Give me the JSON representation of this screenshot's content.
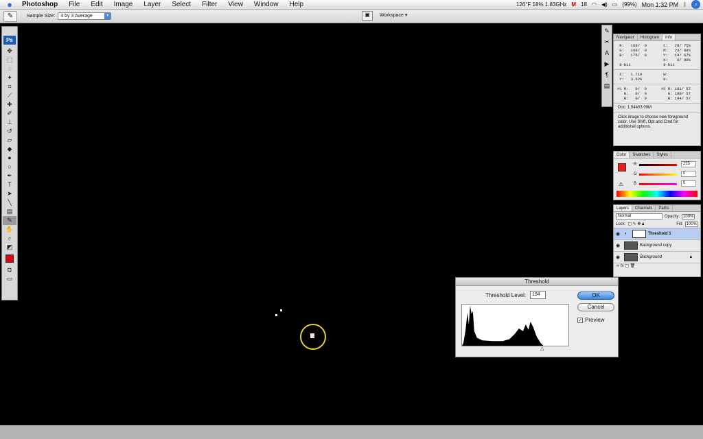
{
  "menubar": {
    "app": "Photoshop",
    "items": [
      "File",
      "Edit",
      "Image",
      "Layer",
      "Select",
      "Filter",
      "View",
      "Window",
      "Help"
    ],
    "status": {
      "temp": "126°F 18% 1.83GHz",
      "mail": "18",
      "battery": "(99%)",
      "clock": "Mon 1:32 PM"
    }
  },
  "options": {
    "sample_label": "Sample Size:",
    "sample_value": "3 by 3 Average",
    "workspace": "Workspace"
  },
  "toolbox": {
    "logo": "Ps"
  },
  "info_panel": {
    "tabs": [
      "Navigator",
      "Histogram",
      "Info"
    ],
    "rgb": " R:   168/  0\n G:   168/  0\n B:   175/  0\n\n 8-bit",
    "cmyk": " C:   29/ 75%\n M:   23/ 68%\n Y:   19/ 67%\n K:    0/ 90%\n 8-bit",
    "xy": " X:   1.719\n Y:   3.626",
    "wh": " W:\n H:",
    "s1": "#1 R:   0/  0\n   G:   0/  0\n   B:   0/  0",
    "s2": "#2 R: 191/ 57\n   G: 190/ 57\n   B: 194/ 57",
    "doc": "Doc: 1.54M/3.09M",
    "desc": "Click image to choose new foreground color. Use Shift, Opt and Cmd for additional options."
  },
  "color_panel": {
    "tabs": [
      "Color",
      "Swatches",
      "Styles"
    ],
    "r": "255",
    "g": "0",
    "b": "0",
    "fg_color": "#ec1b1b"
  },
  "layers_panel": {
    "tabs": [
      "Layers",
      "Channels",
      "Paths"
    ],
    "blend_mode": "Normal",
    "opacity_label": "Opacity:",
    "opacity": "100%",
    "lock_label": "Lock:",
    "fill_label": "Fill:",
    "fill": "100%",
    "layers": [
      {
        "name": "Threshold 1"
      },
      {
        "name": "Background copy"
      },
      {
        "name": "Background"
      }
    ]
  },
  "dialog": {
    "title": "Threshold",
    "level_label": "Threshold Level:",
    "level_value": "194",
    "ok": "OK",
    "cancel": "Cancel",
    "preview": "Preview"
  }
}
